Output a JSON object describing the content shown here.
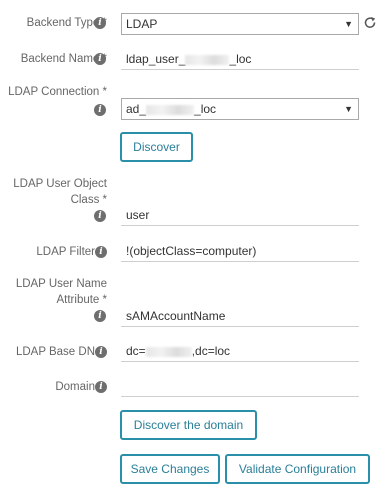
{
  "form": {
    "backend_type": {
      "label": "Backend Type *",
      "value": "LDAP"
    },
    "backend_name": {
      "label": "Backend Name *",
      "value_prefix": "ldap_user_",
      "value_suffix": "_loc"
    },
    "ldap_connection": {
      "label": "LDAP Connection *",
      "value_prefix": "ad_",
      "value_suffix": "_loc"
    },
    "discover_button": "Discover",
    "user_object_class": {
      "label": "LDAP User Object Class *",
      "value": "user"
    },
    "ldap_filter": {
      "label": "LDAP Filter",
      "value": "!(objectClass=computer)"
    },
    "user_name_attribute": {
      "label": "LDAP User Name Attribute *",
      "value": "sAMAccountName"
    },
    "base_dn": {
      "label": "LDAP Base DN",
      "value_prefix": "dc=",
      "value_suffix": ",dc=loc"
    },
    "domain": {
      "label": "Domain",
      "value": ""
    },
    "discover_domain_button": "Discover the domain",
    "save_button": "Save Changes",
    "validate_button": "Validate Configuration"
  },
  "icons": {
    "info": "info-circle-icon",
    "refresh": "refresh-icon",
    "dropdown": "caret-down-icon"
  },
  "colors": {
    "accent": "#2a8fa8",
    "icon": "#6e6e6e"
  }
}
